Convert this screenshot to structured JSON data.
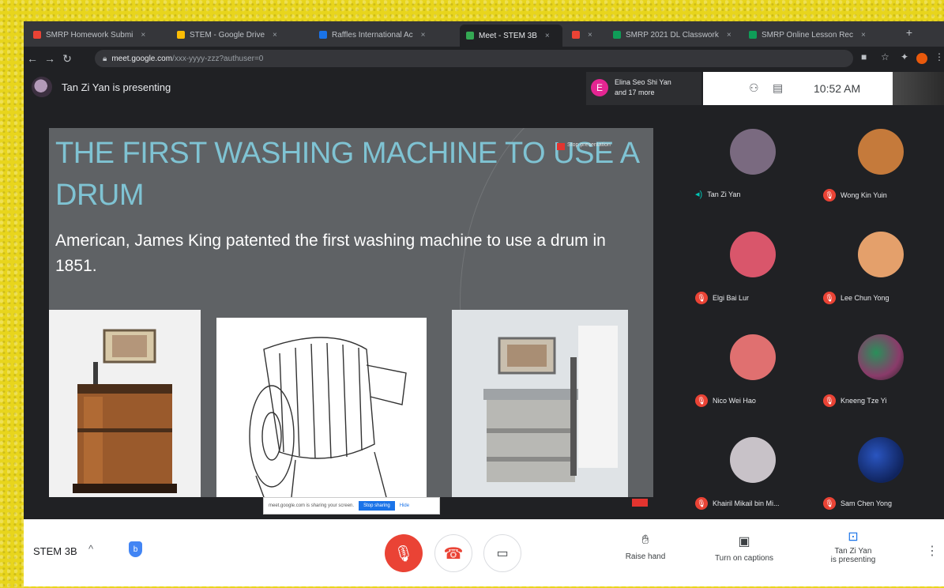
{
  "browser": {
    "tabs": [
      {
        "label": "SMRP Homework Submi",
        "color": "#ea4335"
      },
      {
        "label": "STEM - Google Drive",
        "color": "#fbbc04"
      },
      {
        "label": "Raffles International Ac",
        "color": "#1a73e8"
      },
      {
        "label": "Meet - STEM 3B",
        "color": "#34a853",
        "active": true
      },
      {
        "label": "",
        "color": "#ea4335"
      },
      {
        "label": "SMRP 2021 DL Classwork",
        "color": "#0f9d58"
      },
      {
        "label": "SMRP Online Lesson Rec",
        "color": "#0f9d58"
      }
    ],
    "new_tab": "+",
    "url_host": "meet.google.com",
    "url_path": "/xxx-yyyy-zzz?authuser=0"
  },
  "meet": {
    "presenter_text": "Tan Zi Yan is presenting",
    "notification": {
      "initial": "E",
      "line1": "Elina Seo Shi Yan",
      "line2": "and 17 more"
    },
    "time": "10:52 AM",
    "meeting_name": "STEM 3B",
    "controls": {
      "raise_hand": "Raise hand",
      "captions": "Turn on captions",
      "presenting_line1": "Tan Zi Yan",
      "presenting_line2": "is presenting"
    },
    "caption_banner": {
      "text": "meet.google.com is sharing your screen.",
      "share": "Stop sharing",
      "hide": "Hide"
    },
    "recording_label": "Stop presentation"
  },
  "slide": {
    "title": "THE FIRST WASHING MACHINE TO USE A DRUM",
    "body": "American, James King patented the first washing machine to use a drum in 1851."
  },
  "participants": [
    {
      "name": "Tan Zi Yan",
      "speaking": true,
      "avatar": "#7a6a80"
    },
    {
      "name": "Wong Kin Yuin",
      "speaking": false,
      "avatar": "#c57a3b"
    },
    {
      "name": "Elgi Bai Lur",
      "speaking": false,
      "avatar": "#d9566b"
    },
    {
      "name": "Lee Chun Yong",
      "speaking": false,
      "avatar": "#e4a06b"
    },
    {
      "name": "Nico Wei Hao",
      "speaking": false,
      "avatar": "#e07070"
    },
    {
      "name": "Kneeng Tze Yi",
      "speaking": false,
      "avatar": "#8a3b6a"
    },
    {
      "name": "Khairil Mikail bin Mi...",
      "speaking": false,
      "avatar": "#c8c2c8"
    },
    {
      "name": "Sam Chen Yong",
      "speaking": false,
      "avatar": "#1d3f8f"
    }
  ],
  "colors": {
    "accent": "#1a73e8",
    "danger": "#ea4335",
    "title_text": "#7fc3d3"
  }
}
